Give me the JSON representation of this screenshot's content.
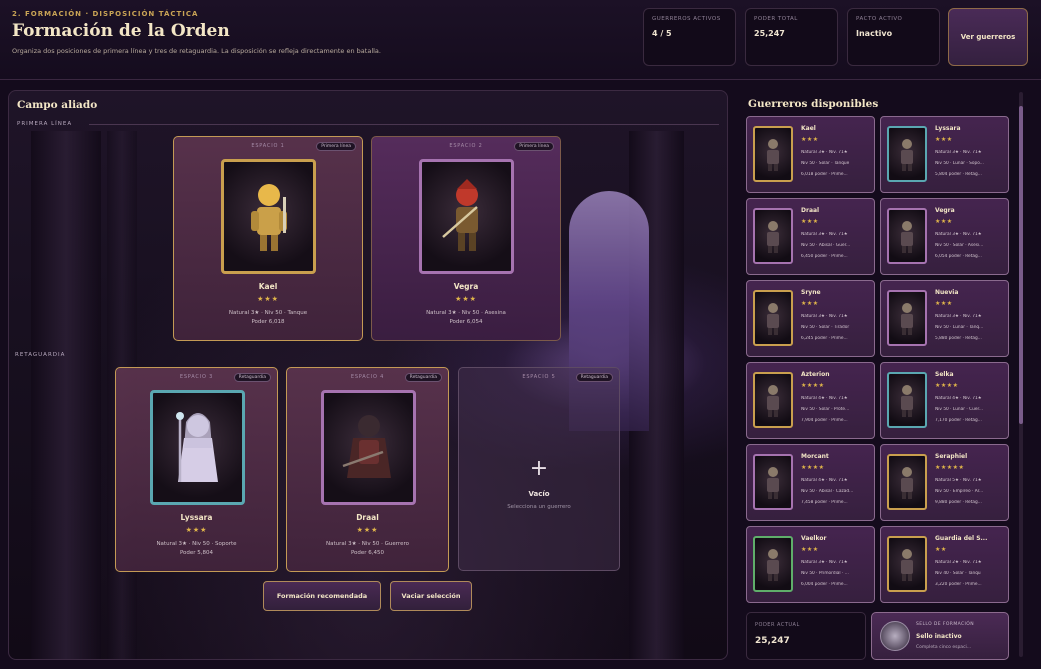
{
  "header": {
    "eyebrow": "2. FORMACIÓN · DISPOSICIÓN TÁCTICA",
    "title": "Formación de la Orden",
    "subtitle": "Organiza dos posiciones de primera línea y tres de retaguardia. La disposición se refleja directamente en batalla.",
    "stats": [
      {
        "label": "GUERREROS ACTIVOS",
        "value": "4 / 5"
      },
      {
        "label": "PODER TOTAL",
        "value": "25,247"
      },
      {
        "label": "PACTO ACTIVO",
        "value": "Inactivo"
      }
    ],
    "roster_button": "Ver guerreros"
  },
  "field": {
    "title": "Campo aliado",
    "front_label": "PRIMERA LÍNEA",
    "back_label": "RETAGUARDIA",
    "slots": [
      {
        "head": "ESPACIO 1",
        "tag": "Primera línea",
        "name": "Kael",
        "stars": "★★★",
        "meta1": "Natural 3★ · Niv 50 · Tanque",
        "meta2": "Poder 6,018",
        "frame": "gold",
        "icon": "knight-gold-icon"
      },
      {
        "head": "ESPACIO 2",
        "tag": "Primera línea",
        "name": "Vegra",
        "stars": "★★★",
        "meta1": "Natural 3★ · Niv 50 · Asesina",
        "meta2": "Poder 6,054",
        "frame": "purple",
        "icon": "red-warrior-icon"
      },
      {
        "head": "ESPACIO 3",
        "tag": "Retaguardia",
        "name": "Lyssara",
        "stars": "★★★",
        "meta1": "Natural 3★ · Niv 50 · Soporte",
        "meta2": "Poder 5,804",
        "frame": "teal",
        "icon": "priestess-icon"
      },
      {
        "head": "ESPACIO 4",
        "tag": "Retaguardia",
        "name": "Draal",
        "stars": "★★★",
        "meta1": "Natural 3★ · Niv 50 · Guerrero",
        "meta2": "Poder 6,450",
        "frame": "purple",
        "icon": "dark-knight-icon"
      }
    ],
    "empty": {
      "head": "ESPACIO 5",
      "tag": "Retaguardia",
      "plus": "+",
      "title": "Vacío",
      "hint": "Selecciona un guerrero"
    },
    "buttons": {
      "recommended": "Formación recomendada",
      "clear": "Vaciar selección"
    }
  },
  "roster": {
    "title": "Guerreros disponibles",
    "cards": [
      {
        "name": "Kael",
        "stars": "★★★",
        "l1": "Natural 3★ · Niv. 71★",
        "l2": "Niv 50 · Solar · Tanque",
        "l3": "6,018 poder · Prime...",
        "frame": "gold"
      },
      {
        "name": "Lyssara",
        "stars": "★★★",
        "l1": "Natural 3★ · Niv. 71★",
        "l2": "Niv 50 · Lunar · Sopo...",
        "l3": "5,804 poder · Retag...",
        "frame": "teal"
      },
      {
        "name": "Draal",
        "stars": "★★★",
        "l1": "Natural 3★ · Niv. 71★",
        "l2": "Niv 50 · Abisal · Guer...",
        "l3": "6,450 poder · Prime...",
        "frame": "purple"
      },
      {
        "name": "Vegra",
        "stars": "★★★",
        "l1": "Natural 3★ · Niv. 71★",
        "l2": "Niv 50 · Solar · Asesi...",
        "l3": "6,054 poder · Retag...",
        "frame": "purple"
      },
      {
        "name": "Sryne",
        "stars": "★★★",
        "l1": "Natural 3★ · Niv. 71★",
        "l2": "Niv 50 · Solar · Tirador",
        "l3": "6,245 poder · Prime...",
        "frame": "gold"
      },
      {
        "name": "Nuevia",
        "stars": "★★★",
        "l1": "Natural 3★ · Niv. 71★",
        "l2": "Niv 50 · Lunar · Tanq...",
        "l3": "5,880 poder · Retag...",
        "frame": "purple"
      },
      {
        "name": "Azterion",
        "stars": "★★★★",
        "l1": "Natural 4★ · Niv. 71★",
        "l2": "Niv 50 · Solar · Prote...",
        "l3": "7,904 poder · Prime...",
        "frame": "gold"
      },
      {
        "name": "Selka",
        "stars": "★★★★",
        "l1": "Natural 4★ · Niv. 71★",
        "l2": "Niv 50 · Lunar · Cuer...",
        "l3": "7,170 poder · Retag...",
        "frame": "teal"
      },
      {
        "name": "Morcant",
        "stars": "★★★★",
        "l1": "Natural 4★ · Niv. 71★",
        "l2": "Niv 50 · Abisal · Cazad...",
        "l3": "7,458 poder · Prime...",
        "frame": "purple"
      },
      {
        "name": "Seraphiel",
        "stars": "★★★★★",
        "l1": "Natural 5★ · Niv. 71★",
        "l2": "Niv 50 · Empíreo · Ar...",
        "l3": "9,880 poder · Retag...",
        "frame": "gold"
      },
      {
        "name": "Vaelkor",
        "stars": "★★★",
        "l1": "Natural 3★ · Niv. 71★",
        "l2": "Niv 50 · Primordial · ...",
        "l3": "6,004 poder · Prime...",
        "frame": "green"
      },
      {
        "name": "Guardia del S...",
        "stars": "★★",
        "l1": "Natural 2★ · Niv. 71★",
        "l2": "Niv 40 · Solar · Tanqu",
        "l3": "3,220 poder · Prime...",
        "frame": "gold"
      }
    ],
    "power_label": "PODER ACTUAL",
    "power_value": "25,247",
    "seal_label": "SELLO DE FORMACIÓN",
    "seal_value": "Sello inactivo",
    "seal_hint": "Completa cinco espaci..."
  }
}
